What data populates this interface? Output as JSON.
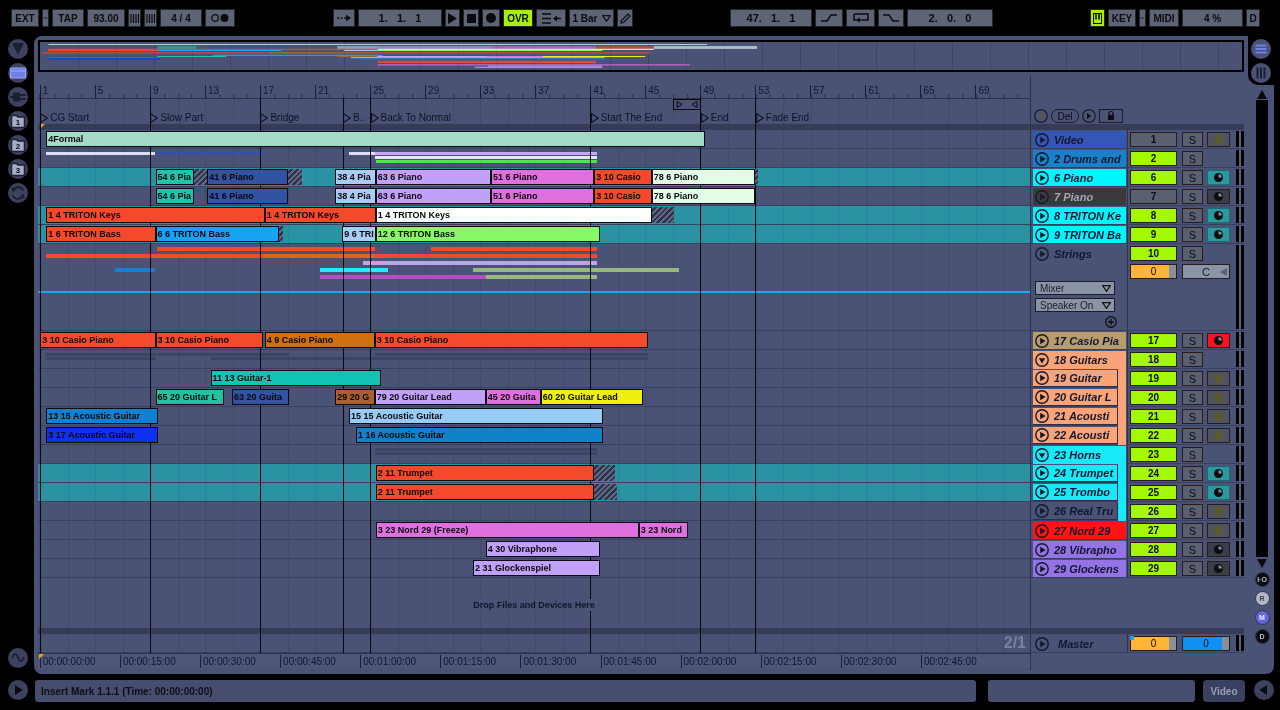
{
  "transport": {
    "sync_button": "EXT",
    "tap_button": "TAP",
    "tempo": "93.00",
    "time_signature": "4 / 4",
    "position": "1.   1.   1",
    "overdub": {
      "label": "OVR",
      "on": true
    },
    "quantization": "1 Bar",
    "loop_start": "47.   1.   1",
    "loop_length": "2.   0.   0",
    "computer_keyboard": {
      "on": true
    },
    "key_button": "KEY",
    "midi_button": "MIDI",
    "cpu_load": "4 %",
    "disk_indicator": "D"
  },
  "browser_tabs": [
    {
      "selected": false
    },
    {
      "selected": true
    },
    {
      "selected": false
    },
    {
      "label": "1",
      "selected": false
    },
    {
      "label": "2",
      "selected": false
    },
    {
      "label": "3",
      "selected": false
    },
    {
      "selected": false
    }
  ],
  "view_toggles": [
    {
      "on": true
    },
    {
      "on": false
    }
  ],
  "ruler": {
    "bars": [
      "1",
      "5",
      "9",
      "13",
      "17",
      "21",
      "25",
      "29",
      "33",
      "37",
      "41",
      "45",
      "49",
      "53",
      "57",
      "61",
      "65",
      "69"
    ]
  },
  "locators": [
    {
      "label": "CG Start"
    },
    {
      "label": "Slow Part"
    },
    {
      "label": "Bridge"
    },
    {
      "label": "B.."
    },
    {
      "label": "Back To Normal"
    },
    {
      "label": "Start The End"
    },
    {
      "label": "End"
    },
    {
      "label": "Fade End"
    }
  ],
  "locator_controls": {
    "delete_button": "Del"
  },
  "tracks": [
    {
      "name": "Video",
      "color": "#3556b4",
      "kind": "track",
      "number": "1",
      "active": false,
      "solo": "S",
      "arm": {
        "kind": "audio",
        "armed": false
      },
      "selected": false,
      "clips": [
        {
          "name": "4Formal",
          "color": "#a6dac8",
          "hatched": false
        }
      ]
    },
    {
      "name": "2 Drums and",
      "color": "#1a80c8",
      "kind": "group",
      "expanded": false,
      "number": "2",
      "active": true,
      "solo": "S",
      "selected": false,
      "strips": [
        [
          {
            "color": "#dcdcf4"
          },
          {
            "color": "#3450a8"
          },
          {
            "color": "#dcdcf4"
          },
          {
            "color": "#c8a8f4"
          }
        ],
        [
          {
            "color": "#e4e4f4"
          }
        ],
        [
          {
            "color": "#48e848"
          }
        ]
      ]
    },
    {
      "name": "6 Piano",
      "color": "#00f4fc",
      "kind": "track",
      "number": "6",
      "active": true,
      "solo": "S",
      "arm": {
        "kind": "midi",
        "armed": false
      },
      "selected": true,
      "clips": [
        {
          "name": "54 6 Pia",
          "color": "#1ec4ac",
          "hatched": true
        },
        {
          "name": "41 6 Piano",
          "color": "#3252a4",
          "hatched": true
        },
        {
          "name": "38 4 Pia",
          "color": "#a8ccf4",
          "hatched": false
        },
        {
          "name": "63 6 Piano",
          "color": "#c0a0f8",
          "hatched": false
        },
        {
          "name": "51 6 Piano",
          "color": "#e070e0",
          "hatched": false
        },
        {
          "name": "3 10 Casio",
          "color": "#f24a2a",
          "hatched": false
        },
        {
          "name": "78 6 Piano",
          "color": "#e2fce8",
          "hatched": true
        }
      ]
    },
    {
      "name": "7 Piano",
      "color": "#3a3a3e",
      "kind": "track",
      "number": "7",
      "active": false,
      "solo": "S",
      "arm": {
        "kind": "midi",
        "armed": false
      },
      "selected": false,
      "clips": [
        {
          "name": "54 6 Pia",
          "color": "#1ec4ac",
          "hatched": false
        },
        {
          "name": "41 6 Piano",
          "color": "#3252a4",
          "hatched": false
        },
        {
          "name": "38 4 Pia",
          "color": "#a8ccf4",
          "hatched": false
        },
        {
          "name": "63 6 Piano",
          "color": "#c0a0f8",
          "hatched": false
        },
        {
          "name": "51 6 Piano",
          "color": "#e070e0",
          "hatched": false
        },
        {
          "name": "3 10 Casio",
          "color": "#f24a2a",
          "hatched": false
        },
        {
          "name": "78 6 Piano",
          "color": "#e2fce8",
          "hatched": false
        }
      ]
    },
    {
      "name": "8 TRITON Ke",
      "color": "#00f4fc",
      "kind": "track",
      "number": "8",
      "active": true,
      "solo": "S",
      "arm": {
        "kind": "midi",
        "armed": false
      },
      "selected": true,
      "clips": [
        {
          "name": "1 4 TRITON Keys",
          "color": "#f24a2a",
          "hatched": false
        },
        {
          "name": "1 4 TRITON Keys",
          "color": "#f24a2a",
          "hatched": false
        },
        {
          "name": "1 4 TRITON Keys",
          "color": "#ffffff",
          "hatched": true
        }
      ]
    },
    {
      "name": "9 TRITON Ba",
      "color": "#00f4fc",
      "kind": "track",
      "number": "9",
      "active": true,
      "solo": "S",
      "arm": {
        "kind": "midi",
        "armed": false
      },
      "selected": true,
      "clips": [
        {
          "name": "1 6 TRITON Bass",
          "color": "#f24a2a",
          "hatched": false
        },
        {
          "name": "6 6 TRITON Bass",
          "color": "#18a2f2",
          "hatched": true
        },
        {
          "name": "9 6 TRI",
          "color": "#a8ccf4",
          "hatched": false
        },
        {
          "name": "12 6 TRITON Bass",
          "color": "#88f868",
          "hatched": false
        }
      ]
    },
    {
      "name": "Strings",
      "color": "#4a5276",
      "kind": "group",
      "expanded": false,
      "number": "10",
      "active": true,
      "solo": "S",
      "selected": false,
      "volume": {
        "value": "0",
        "level": 0.85
      },
      "pan": "C",
      "routing": [
        "Mixer",
        "Speaker On"
      ],
      "automation": true,
      "strips": [
        [
          {
            "color": "#f24a2a"
          },
          {
            "color": "#f24a2a"
          }
        ],
        [
          {
            "color": "#f24a2a"
          },
          {
            "color": "#d86818"
          },
          {
            "color": "#f24a2a"
          }
        ],
        [
          {
            "color": "#c0a0f8"
          }
        ],
        [
          {
            "color": "#1880d0"
          },
          {
            "color": "#28e8ff"
          },
          {
            "color": "#98b880"
          }
        ],
        [
          {
            "color": "#b050c0"
          },
          {
            "color": "#98b880"
          }
        ]
      ]
    },
    {
      "name": "17 Casio Pia",
      "color": "#b89c6c",
      "kind": "track",
      "number": "17",
      "active": true,
      "solo": "S",
      "arm": {
        "kind": "midi",
        "armed": true
      },
      "selected": false,
      "clips": [
        {
          "name": "3 10 Casio Piano",
          "color": "#f24a2a",
          "hatched": false
        },
        {
          "name": "3 10 Casio Piano",
          "color": "#f24a2a",
          "hatched": false
        },
        {
          "name": "4 9 Casio Piano",
          "color": "#d07010",
          "hatched": false
        },
        {
          "name": "3 10 Casio Piano",
          "color": "#f24a2a",
          "hatched": false
        }
      ]
    },
    {
      "name": "18 Guitars",
      "color": "#f8a478",
      "kind": "group",
      "expanded": true,
      "number": "18",
      "active": true,
      "solo": "S",
      "selected": false,
      "strips": [
        [
          {
            "color": "#3c4464"
          },
          {
            "color": "#3c4464"
          },
          {
            "color": "#3c4464"
          }
        ],
        [
          {
            "color": "#3c4464"
          },
          {
            "color": "#3c4464"
          },
          {
            "color": "#3c4464"
          }
        ]
      ],
      "children": [
        {
          "name": "19 Guitar",
          "color": "#f8a478",
          "kind": "track",
          "number": "19",
          "active": true,
          "solo": "S",
          "arm": {
            "kind": "audio",
            "armed": false
          },
          "selected": false,
          "clips": [
            {
              "name": "11 13 Guitar-1",
              "color": "#12c2b2",
              "hatched": false
            }
          ]
        },
        {
          "name": "20 Guitar L",
          "color": "#f8a478",
          "kind": "track",
          "number": "20",
          "active": true,
          "solo": "S",
          "arm": {
            "kind": "audio",
            "armed": false
          },
          "selected": false,
          "clips": [
            {
              "name": "65 20 Guitar L",
              "color": "#20c2a2",
              "hatched": false
            },
            {
              "name": "63 20 Guita",
              "color": "#3252a4",
              "hatched": false
            },
            {
              "name": "29 20 G",
              "color": "#a86030",
              "hatched": false
            },
            {
              "name": "79 20 Guitar Lead",
              "color": "#c0a0f8",
              "hatched": false
            },
            {
              "name": "45 20 Guita",
              "color": "#e070e0",
              "hatched": false
            },
            {
              "name": "60 20 Guitar Lead",
              "color": "#f0f010",
              "hatched": false
            }
          ]
        },
        {
          "name": "21 Acousti",
          "color": "#f8a478",
          "kind": "track",
          "number": "21",
          "active": true,
          "solo": "S",
          "arm": {
            "kind": "audio",
            "armed": false
          },
          "selected": false,
          "clips": [
            {
              "name": "13 15 Acoustic Guitar",
              "color": "#1080d0",
              "hatched": false
            },
            {
              "name": "15 15 Acoustic Guitar",
              "color": "#98ccf8",
              "hatched": false
            }
          ]
        },
        {
          "name": "22 Acousti",
          "color": "#f8a478",
          "kind": "track",
          "number": "22",
          "active": true,
          "solo": "S",
          "arm": {
            "kind": "audio",
            "armed": false
          },
          "selected": false,
          "clips": [
            {
              "name": "3 17 Acoustic Guitar",
              "color": "#1030f0",
              "hatched": false
            },
            {
              "name": "1 16 Acoustic Guitar",
              "color": "#1080c8",
              "hatched": false
            }
          ]
        }
      ]
    },
    {
      "name": "23 Horns",
      "color": "#18e8f8",
      "kind": "group",
      "expanded": true,
      "number": "23",
      "active": true,
      "solo": "S",
      "selected": false,
      "strips": [
        [
          {
            "color": "#3c4464"
          }
        ],
        [
          {
            "color": "#3c4464"
          }
        ]
      ],
      "children": [
        {
          "name": "24 Trumpet",
          "color": "#18e8f8",
          "kind": "track",
          "number": "24",
          "active": true,
          "solo": "S",
          "arm": {
            "kind": "midi",
            "armed": false
          },
          "selected": true,
          "clips": [
            {
              "name": "2 11 Trumpet",
              "color": "#f24a2a",
              "hatched": true
            }
          ]
        },
        {
          "name": "25 Trombo",
          "color": "#18e8f8",
          "kind": "track",
          "number": "25",
          "active": true,
          "solo": "S",
          "arm": {
            "kind": "midi",
            "armed": false
          },
          "selected": true,
          "clips": [
            {
              "name": "2 11 Trumpet",
              "color": "#f24a2a",
              "hatched": true
            }
          ]
        },
        {
          "name": "26 Real Tru",
          "color": "#4a5276",
          "kind": "track",
          "number": "26",
          "active": true,
          "solo": "S",
          "arm": {
            "kind": "audio",
            "armed": false
          },
          "selected": false
        }
      ]
    },
    {
      "name": "27 Nord 29",
      "color": "#ff1414",
      "kind": "track",
      "number": "27",
      "active": true,
      "solo": "S",
      "arm": {
        "kind": "audio",
        "armed": false
      },
      "selected": false,
      "clips": [
        {
          "name": "3 23 Nord 29 (Freeze)",
          "color": "#e070e0",
          "hatched": false
        },
        {
          "name": "3 23 Nord",
          "color": "#e070e0",
          "hatched": false
        }
      ]
    },
    {
      "name": "28 Vibrapho",
      "color": "#9474e4",
      "kind": "track",
      "number": "28",
      "active": true,
      "solo": "S",
      "arm": {
        "kind": "midi",
        "armed": false
      },
      "selected": false,
      "clips": [
        {
          "name": "4 30 Vibraphone",
          "color": "#c0a0f8",
          "hatched": false
        }
      ]
    },
    {
      "name": "29 Glockens",
      "color": "#9474e4",
      "kind": "track",
      "number": "29",
      "active": true,
      "solo": "S",
      "arm": {
        "kind": "midi",
        "armed": false
      },
      "selected": false,
      "clips": [
        {
          "name": "2 31 Glockenspiel",
          "color": "#c0a0f8",
          "hatched": false
        }
      ]
    }
  ],
  "drop_hint": "Drop Files and Devices Here",
  "master": {
    "name": "Master",
    "lane_label": "2/1",
    "volume": {
      "value": "0",
      "level": 0.85
    },
    "cue_volume": {
      "value": "0",
      "level": 0.85
    }
  },
  "time_ruler": [
    "00:00:00:00",
    "00:00:15:00",
    "00:00:30:00",
    "00:00:45:00",
    "00:01:00:00",
    "00:01:15:00",
    "00:01:30:00",
    "00:01:45:00",
    "00:02:00:00",
    "00:02:15:00",
    "00:02:30:00",
    "00:02:45:00"
  ],
  "view_buttons": [
    {
      "label": "I·O",
      "color": "#0c0c0e"
    },
    {
      "label": "R",
      "color": "#b4b8c4"
    },
    {
      "label": "M",
      "color": "#6464e0"
    },
    {
      "label": "D",
      "color": "#0c0c0e"
    }
  ],
  "status_bar": {
    "message": "Insert Mark 1.1.1 (Time: 00:00:00:00)",
    "video_button": "Video"
  }
}
